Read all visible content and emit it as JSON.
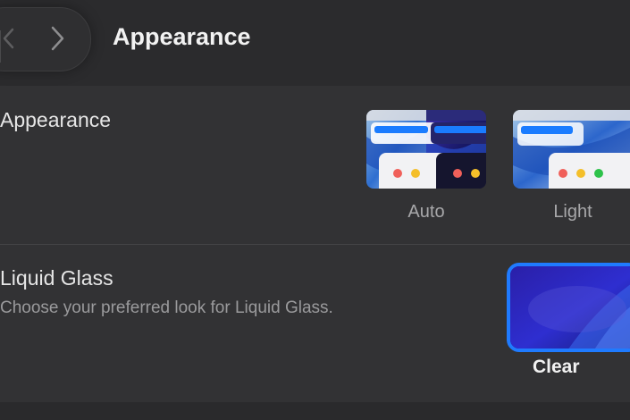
{
  "header": {
    "title": "Appearance",
    "back_icon": "chevron-left-icon",
    "forward_icon": "chevron-right-icon"
  },
  "appearance": {
    "label": "Appearance",
    "options": [
      {
        "label": "Auto",
        "selected": false
      },
      {
        "label": "Light",
        "selected": false
      }
    ]
  },
  "liquid_glass": {
    "title": "Liquid Glass",
    "description": "Choose your preferred look for Liquid Glass.",
    "options": [
      {
        "label": "Clear",
        "selected": true
      }
    ]
  },
  "colors": {
    "accent": "#1f7bff",
    "background": "#2a2a2c",
    "card": "#323234"
  }
}
